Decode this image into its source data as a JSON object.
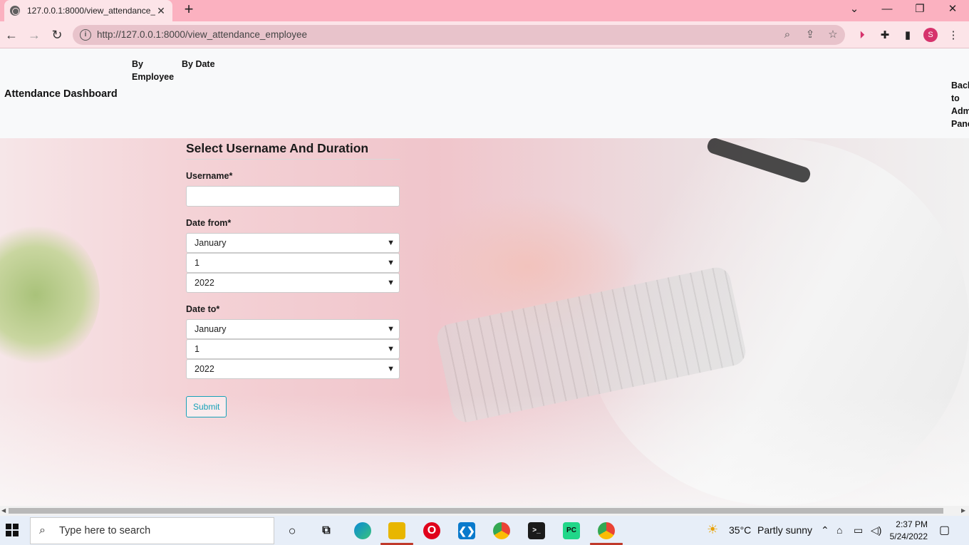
{
  "browser": {
    "tab_title": "127.0.0.1:8000/view_attendance_",
    "url": "http://127.0.0.1:8000/view_attendance_employee",
    "profile_initial": "S"
  },
  "navbar": {
    "brand": "Attendance Dashboard",
    "links": [
      "By Employee",
      "By Date"
    ],
    "back_link": "Back to Admin Panel"
  },
  "form": {
    "heading": "Select Username And Duration",
    "username_label": "Username*",
    "username_value": "",
    "date_from_label": "Date from*",
    "date_from": {
      "month": "January",
      "day": "1",
      "year": "2022"
    },
    "date_to_label": "Date to*",
    "date_to": {
      "month": "January",
      "day": "1",
      "year": "2022"
    },
    "submit_label": "Submit"
  },
  "taskbar": {
    "search_placeholder": "Type here to search",
    "weather_temp": "35°C",
    "weather_desc": "Partly sunny",
    "time": "2:37 PM",
    "date": "5/24/2022"
  },
  "colors": {
    "tab_strip": "#fbb1c0",
    "toolbar": "#fce4e8",
    "accent": "#17a2b8"
  }
}
